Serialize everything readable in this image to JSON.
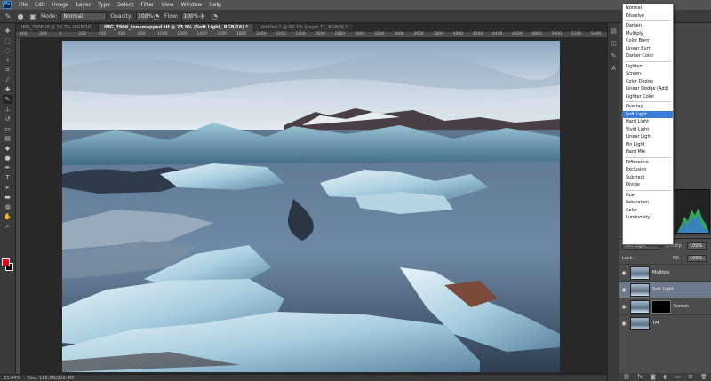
{
  "menubar": {
    "logo": "Ps",
    "items": [
      "File",
      "Edit",
      "Image",
      "Layer",
      "Type",
      "Select",
      "Filter",
      "View",
      "Window",
      "Help"
    ]
  },
  "options": {
    "mode_label": "Mode:",
    "mode_value": "Normal",
    "opacity_label": "Opacity:",
    "opacity_value": "100%",
    "flow_label": "Flow:",
    "flow_value": "100%"
  },
  "tabs": [
    {
      "label": "IMG_7906.tif @ 16.7% (RGB/16)",
      "active": false
    },
    {
      "label": "IMG_7906_tonemapped.tif @ 23.9% (Soft Light, RGB/16) *",
      "active": true
    },
    {
      "label": "Untitled-1 @ 62.1% (Layer 11, RGB/8) *",
      "active": false
    }
  ],
  "ruler_ticks": [
    "400",
    "200",
    "0",
    "200",
    "400",
    "600",
    "800",
    "1000",
    "1200",
    "1400",
    "1600",
    "1800",
    "2000",
    "2200",
    "2400",
    "2600",
    "2800",
    "3000",
    "3200",
    "3400",
    "3600",
    "3800",
    "4000",
    "4200",
    "4400",
    "4600",
    "4800",
    "5000",
    "5200",
    "5400"
  ],
  "statusbar": {
    "zoom": "23.94%",
    "doc": "Doc: 128.3M/216.4M"
  },
  "blend_modes": [
    [
      "Normal",
      "Dissolve"
    ],
    [
      "Darken",
      "Multiply",
      "Color Burn",
      "Linear Burn",
      "Darker Color"
    ],
    [
      "Lighten",
      "Screen",
      "Color Dodge",
      "Linear Dodge (Add)",
      "Lighter Color"
    ],
    [
      "Overlay",
      "Soft Light",
      "Hard Light",
      "Vivid Light",
      "Linear Light",
      "Pin Light",
      "Hard Mix"
    ],
    [
      "Difference",
      "Exclusion",
      "Subtract",
      "Divide"
    ],
    [
      "Hue",
      "Saturation",
      "Color",
      "Luminosity"
    ]
  ],
  "blend_selected": "Soft Light",
  "layers_panel": {
    "blend_value": "Soft Light",
    "opacity_label": "Opacity:",
    "opacity_value": "100%",
    "lock_label": "Lock:",
    "fill_label": "Fill:",
    "fill_value": "100%",
    "layers": [
      {
        "name": "Multiply",
        "selected": false,
        "mask": false
      },
      {
        "name": "Soft Light",
        "selected": true,
        "mask": false
      },
      {
        "name": "Screen",
        "selected": false,
        "mask": true
      },
      {
        "name": "TM",
        "selected": false,
        "mask": false
      }
    ]
  },
  "colors": {
    "foreground": "#e00016",
    "background": "#000000",
    "selection": "#3a7bd5"
  }
}
